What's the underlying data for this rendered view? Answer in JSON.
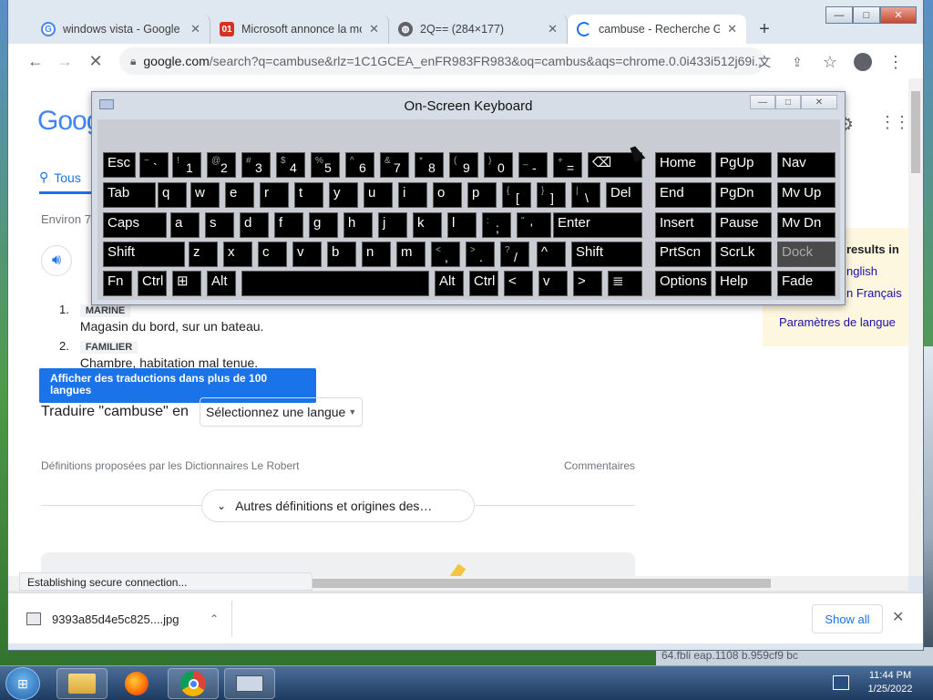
{
  "window": {
    "tabs": [
      {
        "title": "windows vista - Google S",
        "favicon": "google-g",
        "color": "#4285f4"
      },
      {
        "title": "Microsoft annonce la mo",
        "favicon": "01net",
        "color": "#d93025"
      },
      {
        "title": "2Q== (284×177)",
        "favicon": "globe",
        "color": "#5f6368"
      },
      {
        "title": "cambuse - Recherche Go",
        "favicon": "loading-spinner",
        "color": "#1a73e8"
      }
    ],
    "controls": {
      "minimize": "—",
      "maximize": "□",
      "close": "✕"
    }
  },
  "toolbar": {
    "url_host": "google.com",
    "url_path": "/search?q=cambuse&rlz=1C1GCEA_enFR983FR983&oq=cambus&aqs=chrome.0.0i433i512j69i..."
  },
  "page": {
    "logo": "Goog",
    "tab_all": "Tous",
    "result_count": "Environ 7",
    "def_items": [
      {
        "num": "1.",
        "tag": "MARINE",
        "text": "Magasin du bord, sur un bateau."
      },
      {
        "num": "2.",
        "tag": "FAMILIER",
        "text": "Chambre, habitation mal tenue."
      }
    ],
    "tooltip": "Afficher des traductions dans plus de 100 langues",
    "translate_label": "Traduire \"cambuse\" en",
    "translate_select": "Sélectionnez une langue",
    "source_note": "Définitions proposées par les Dictionnaires Le Robert",
    "comments": "Commentaires",
    "more_defs": "Autres définitions et origines des…",
    "side_panel": {
      "heading": "results in",
      "link_english": "nglish",
      "link_french": "n Français",
      "settings": "Paramètres de langue"
    }
  },
  "status_text": "Establishing secure connection...",
  "download": {
    "filename": "9393a85d4e5c825....jpg",
    "show_all": "Show all"
  },
  "osk": {
    "title": "On-Screen Keyboard",
    "rows": [
      [
        {
          "label": "Esc"
        },
        {
          "sub": "~",
          "label": "`"
        },
        {
          "sub": "!",
          "label": "1"
        },
        {
          "sub": "@",
          "label": "2"
        },
        {
          "sub": "#",
          "label": "3"
        },
        {
          "sub": "$",
          "label": "4"
        },
        {
          "sub": "%",
          "label": "5"
        },
        {
          "sub": "^",
          "label": "6"
        },
        {
          "sub": "&",
          "label": "7"
        },
        {
          "sub": "*",
          "label": "8"
        },
        {
          "sub": "(",
          "label": "9"
        },
        {
          "sub": ")",
          "label": "0"
        },
        {
          "sub": "_",
          "label": "-"
        },
        {
          "sub": "+",
          "label": "="
        },
        {
          "label": "⌫"
        },
        {
          "label": "Home"
        },
        {
          "label": "PgUp"
        },
        {
          "label": "Nav"
        }
      ],
      [
        {
          "label": "Tab"
        },
        {
          "label": "q"
        },
        {
          "label": "w"
        },
        {
          "label": "e"
        },
        {
          "label": "r"
        },
        {
          "label": "t"
        },
        {
          "label": "y"
        },
        {
          "label": "u"
        },
        {
          "label": "i"
        },
        {
          "label": "o"
        },
        {
          "label": "p"
        },
        {
          "sub": "{",
          "label": "["
        },
        {
          "sub": "}",
          "label": "]"
        },
        {
          "sub": "|",
          "label": "\\"
        },
        {
          "label": "Del"
        },
        {
          "label": "End"
        },
        {
          "label": "PgDn"
        },
        {
          "label": "Mv Up"
        }
      ],
      [
        {
          "label": "Caps"
        },
        {
          "label": "a"
        },
        {
          "label": "s"
        },
        {
          "label": "d"
        },
        {
          "label": "f"
        },
        {
          "label": "g"
        },
        {
          "label": "h"
        },
        {
          "label": "j"
        },
        {
          "label": "k"
        },
        {
          "label": "l"
        },
        {
          "sub": ":",
          "label": ";"
        },
        {
          "sub": "\"",
          "label": "'"
        },
        {
          "label": "Enter"
        },
        {
          "label": "Insert"
        },
        {
          "label": "Pause"
        },
        {
          "label": "Mv Dn"
        }
      ],
      [
        {
          "label": "Shift"
        },
        {
          "label": "z"
        },
        {
          "label": "x"
        },
        {
          "label": "c"
        },
        {
          "label": "v"
        },
        {
          "label": "b"
        },
        {
          "label": "n"
        },
        {
          "label": "m"
        },
        {
          "sub": "<",
          "label": ","
        },
        {
          "sub": ">",
          "label": "."
        },
        {
          "sub": "?",
          "label": "/"
        },
        {
          "label": "^"
        },
        {
          "label": "Shift"
        },
        {
          "label": "PrtScn"
        },
        {
          "label": "ScrLk"
        },
        {
          "label": "Dock",
          "disabled": true
        }
      ],
      [
        {
          "label": "Fn"
        },
        {
          "label": "Ctrl"
        },
        {
          "label": "⊞"
        },
        {
          "label": "Alt"
        },
        {
          "label": ""
        },
        {
          "label": "Alt"
        },
        {
          "label": "Ctrl"
        },
        {
          "label": "<"
        },
        {
          "label": "v"
        },
        {
          "label": ">"
        },
        {
          "label": "≣"
        },
        {
          "label": "Options"
        },
        {
          "label": "Help"
        },
        {
          "label": "Fade"
        }
      ]
    ]
  },
  "taskbar": {
    "clock_time": "11:44 PM",
    "clock_date": "1/25/2022",
    "desktop_text": "64.fbli  eap.1108  b.959cf9  bc"
  }
}
